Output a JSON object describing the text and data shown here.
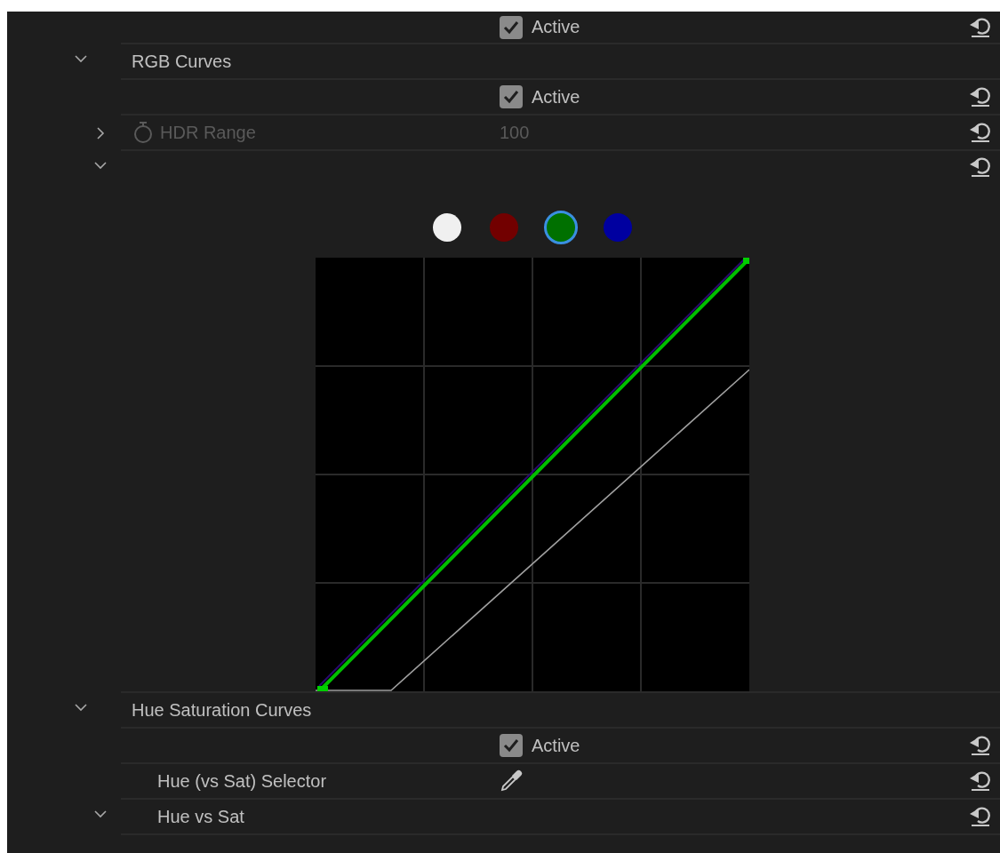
{
  "rows": [
    {
      "kind": "checkbox",
      "label": "Active",
      "checked": true
    },
    {
      "kind": "section",
      "label": "RGB Curves",
      "expanded": true,
      "children": [
        {
          "kind": "checkbox",
          "label": "Active",
          "checked": true
        },
        {
          "kind": "param",
          "label": "HDR Range",
          "value": "100",
          "expanded": false,
          "disabled": true
        },
        {
          "kind": "curves",
          "expanded": true,
          "channels": [
            {
              "color": "#f0f0f0",
              "selected": false
            },
            {
              "color": "#720000",
              "selected": false
            },
            {
              "color": "#007000",
              "selected": true
            },
            {
              "color": "#0000a0",
              "selected": false
            }
          ]
        }
      ]
    },
    {
      "kind": "section",
      "label": "Hue Saturation Curves",
      "expanded": true,
      "children": [
        {
          "kind": "checkbox",
          "label": "Active",
          "checked": true
        },
        {
          "kind": "eyedropper",
          "label": "Hue (vs Sat) Selector"
        },
        {
          "kind": "subsection",
          "label": "Hue vs Sat",
          "expanded": true
        }
      ]
    }
  ]
}
